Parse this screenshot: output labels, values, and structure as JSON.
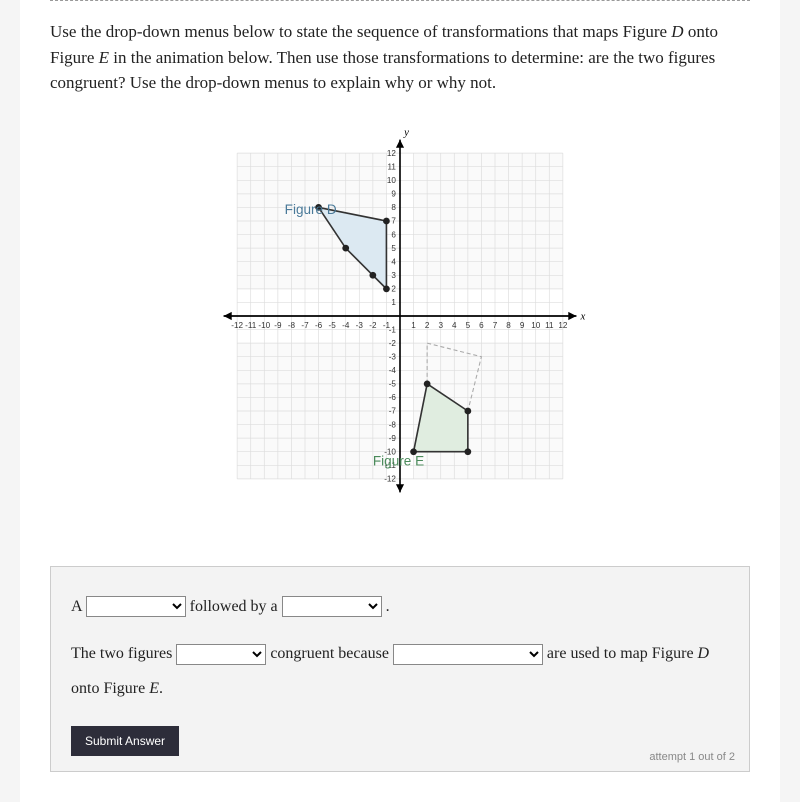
{
  "instructions": {
    "pre1": "Use the drop-down menus below to state the sequence of transformations that maps Figure ",
    "fig1": "D",
    "mid1": " onto Figure ",
    "fig2": "E",
    "post1": " in the animation below. Then use those transformations to determine: are the two figures congruent? Use the drop-down menus to explain why or why not."
  },
  "graph": {
    "labelD": "Figure D",
    "labelE": "Figure E",
    "xlabel": "x",
    "ylabel": "y",
    "range": 12,
    "figureD_points": [
      [
        -6,
        8
      ],
      [
        -1,
        7
      ],
      [
        -1,
        2
      ],
      [
        -2,
        3
      ],
      [
        -4,
        5
      ]
    ],
    "figureE_points": [
      [
        2,
        -5
      ],
      [
        5,
        -7
      ],
      [
        5,
        -10
      ],
      [
        1,
        -10
      ]
    ]
  },
  "answer": {
    "line1_a": "A ",
    "line1_b": " followed by a ",
    "line1_c": " .",
    "line2_a": "The two figures ",
    "line2_b": " congruent because ",
    "line2_c": " are used to map Figure ",
    "line2_figD": "D",
    "line2_mid": " onto Figure ",
    "line2_figE": "E",
    "line2_end": ".",
    "submit": "Submit Answer",
    "attempt": "attempt 1 out of 2"
  }
}
